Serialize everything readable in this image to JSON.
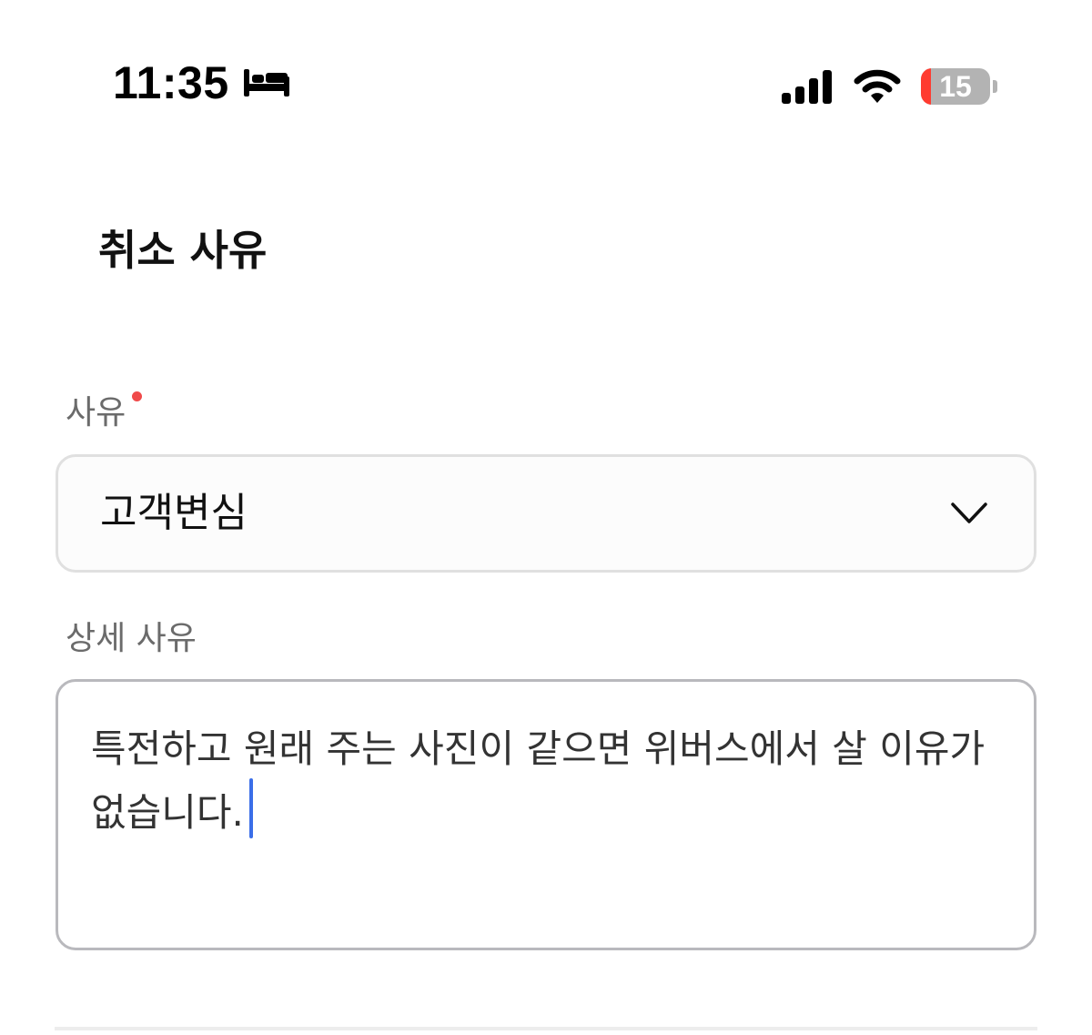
{
  "status_bar": {
    "time": "11:35",
    "focus_icon": "bed-icon",
    "signal_icon": "cellular-signal-icon",
    "wifi_icon": "wifi-icon",
    "battery_level": "15",
    "battery_fraction": 0.15,
    "battery_low_color": "#ff3b30"
  },
  "page": {
    "title": "취소 사유"
  },
  "reason_field": {
    "label": "사유",
    "required": true,
    "required_color": "#f04a4a",
    "selected_value": "고객변심",
    "dropdown_icon": "chevron-down-icon"
  },
  "detail_field": {
    "label": "상세 사유",
    "value": "특전하고 원래 주는 사진이 같으면 위버스에서 살 이유가 없습니다.",
    "caret_color": "#3a6ee8"
  }
}
